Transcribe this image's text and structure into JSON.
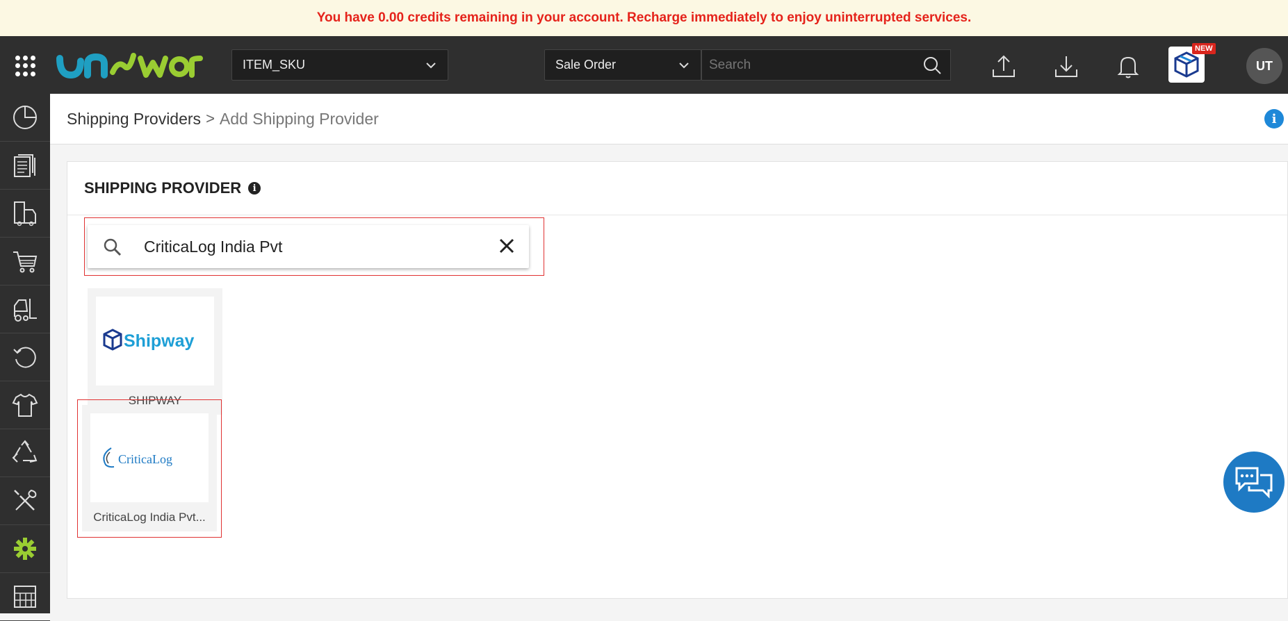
{
  "banner": {
    "message": "You have 0.00 credits remaining in your account. Recharge immediately to enjoy uninterrupted services."
  },
  "header": {
    "sku_select": "ITEM_SKU",
    "order_select": "Sale Order",
    "search_placeholder": "Search",
    "new_badge": "NEW",
    "avatar_initials": "UT"
  },
  "sidebar": {
    "items": [
      {
        "icon": "dashboard-icon"
      },
      {
        "icon": "documents-icon"
      },
      {
        "icon": "shipping-truck-icon"
      },
      {
        "icon": "cart-icon"
      },
      {
        "icon": "forklift-icon"
      },
      {
        "icon": "returns-icon"
      },
      {
        "icon": "product-shirt-icon"
      },
      {
        "icon": "recycle-icon"
      },
      {
        "icon": "tools-icon"
      },
      {
        "icon": "settings-gear-icon"
      },
      {
        "icon": "warehouse-shelf-icon"
      }
    ],
    "active_color": "#9acd32"
  },
  "breadcrumb": {
    "parent": "Shipping Providers",
    "separator": ">",
    "current": "Add Shipping Provider"
  },
  "panel": {
    "title": "SHIPPING PROVIDER",
    "search_value": "CriticaLog India Pvt"
  },
  "providers": [
    {
      "name": "SHIPWAY",
      "logo_text": "Shipway"
    },
    {
      "name": "CriticaLog India Pvt...",
      "logo_text": "CriticaLog"
    }
  ],
  "colors": {
    "banner_text": "#e5231b",
    "topbar": "#2f2f2f",
    "accent_blue": "#1e88d8",
    "highlight_red": "#e03131"
  }
}
